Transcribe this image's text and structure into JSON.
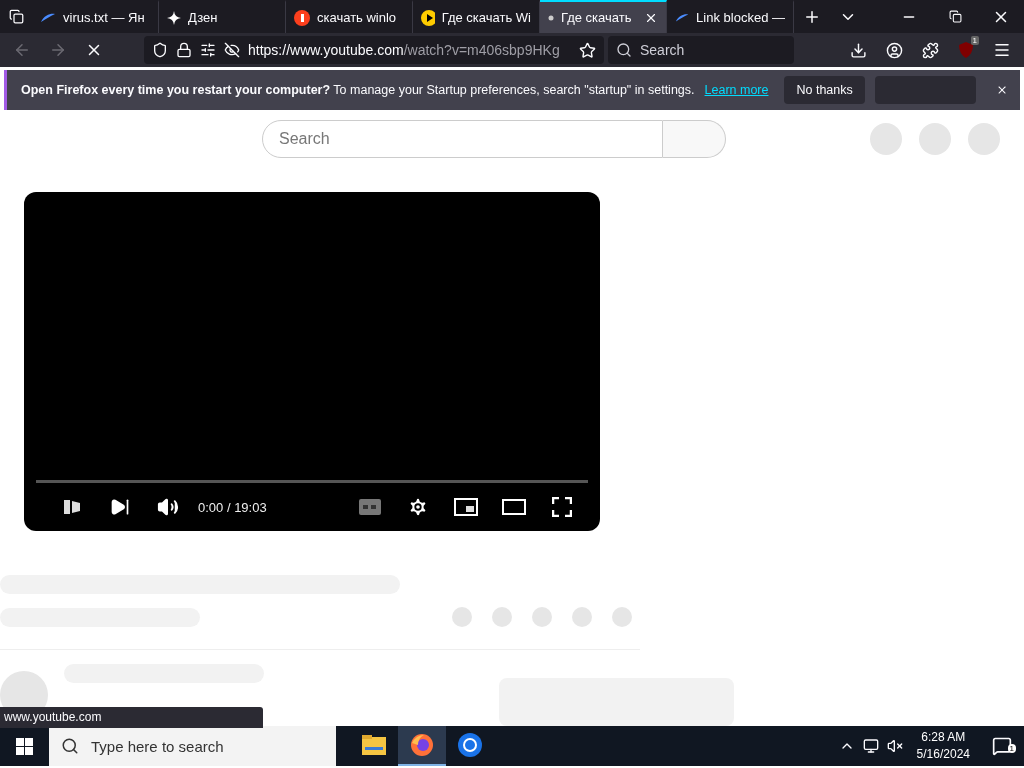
{
  "tabs": [
    {
      "title": "virus.txt — Ян",
      "kind": "swoosh",
      "selected": false
    },
    {
      "title": "Дзен",
      "kind": "spark",
      "selected": false
    },
    {
      "title": "скачать winlo",
      "kind": "red",
      "selected": false
    },
    {
      "title": "Где скачать Wi",
      "kind": "play",
      "selected": false
    },
    {
      "title": "Где скачать",
      "kind": "dot",
      "selected": true
    },
    {
      "title": "Link blocked —",
      "kind": "swoosh",
      "selected": false
    }
  ],
  "toolbar": {
    "url_host": "https://www.youtube.com",
    "url_path": "/watch?v=m406sbp9HKg",
    "search_placeholder": "Search",
    "badge": "1"
  },
  "notification": {
    "message": "**Open Firefox every time you restart your computer?** To manage your Startup preferences, search \"startup\" in settings.",
    "link": "Learn more",
    "buttons": [
      "No thanks"
    ]
  },
  "page": {
    "search_placeholder": "Search"
  },
  "player": {
    "time": "0:00 / 19:03"
  },
  "status": "www.youtube.com",
  "taskbar": {
    "search_placeholder": "Type here to search",
    "apps": [
      {
        "kind": "explorer",
        "selected": false
      },
      {
        "kind": "firefox",
        "selected": true
      },
      {
        "kind": "chrome",
        "selected": false
      }
    ],
    "time": "6:28 AM",
    "date": "5/16/2024",
    "notifications": "1"
  }
}
